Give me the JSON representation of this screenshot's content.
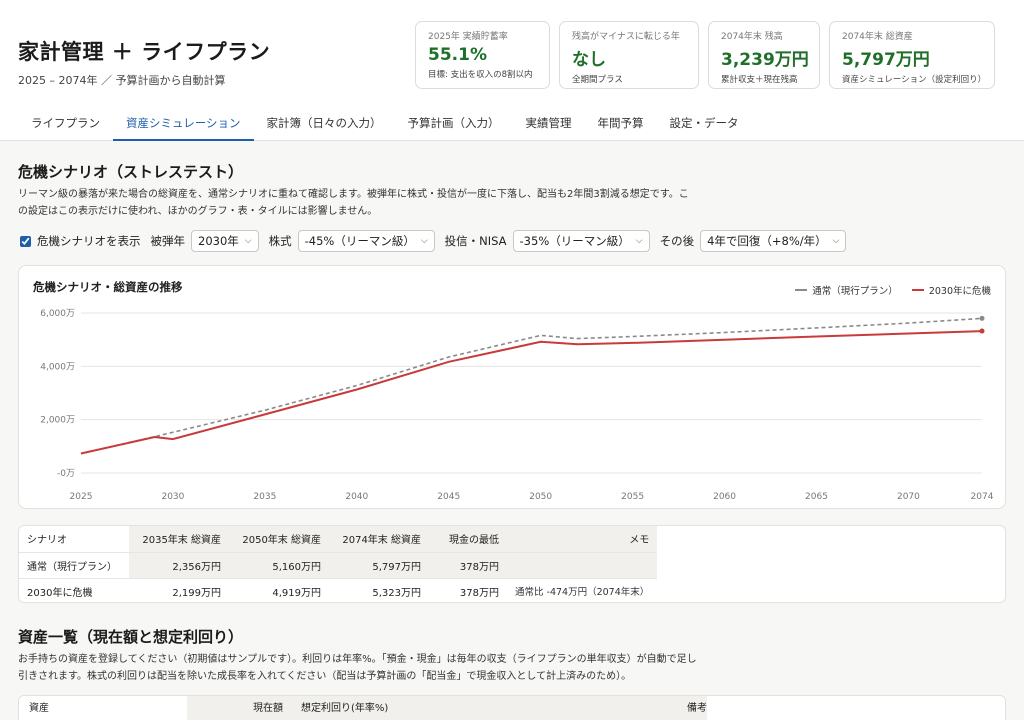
{
  "header": {
    "title": "家計管理 ＋ ライフプラン",
    "subtitle": "2025 – 2074年 ／ 予算計画から自動計算"
  },
  "kpis": [
    {
      "label": "2025年 実績貯蓄率",
      "value": "55.1%",
      "note": "目標: 支出を収入の8割以内"
    },
    {
      "label": "残高がマイナスに転じる年",
      "value": "なし",
      "note": "全期間プラス"
    },
    {
      "label": "2074年末 残高",
      "value": "3,239万円",
      "note": "累計収支＋現在残高"
    },
    {
      "label": "2074年末 総資産",
      "value": "5,797万円",
      "note": "資産シミュレーション（設定利回り）"
    }
  ],
  "tabs": [
    {
      "label": "ライフプラン",
      "active": false
    },
    {
      "label": "資産シミュレーション",
      "active": true
    },
    {
      "label": "家計簿（日々の入力）",
      "active": false
    },
    {
      "label": "予算計画（入力）",
      "active": false
    },
    {
      "label": "実績管理",
      "active": false
    },
    {
      "label": "年間予算",
      "active": false
    },
    {
      "label": "設定・データ",
      "active": false
    }
  ],
  "crisis": {
    "title": "危機シナリオ（ストレステスト）",
    "desc1": "リーマン級の暴落が来た場合の総資産を、通常シナリオに重ねて確認します。被弾年に株式・投信が一度に下落し、配当も2年間3割減る想定です。こ",
    "desc2": "の設定はこの表示だけに使われ、ほかのグラフ・表・タイルには影響しません。",
    "checkbox_label": "危機シナリオを表示",
    "year_label": "被弾年",
    "year_value": "2030年",
    "stock_label": "株式",
    "stock_value": "-45%（リーマン級）",
    "fund_label": "投信・NISA",
    "fund_value": "-35%（リーマン級）",
    "after_label": "その後",
    "after_value": "4年で回復（+8%/年）"
  },
  "chart_data": {
    "type": "line",
    "title": "危機シナリオ・総資産の推移",
    "xlim": [
      2025,
      2074
    ],
    "ylim": [
      0,
      6000
    ],
    "x_ticks": [
      2025,
      2030,
      2035,
      2040,
      2045,
      2050,
      2055,
      2060,
      2065,
      2070,
      2074
    ],
    "x_tick_labels": [
      "2025",
      "2030",
      "2035",
      "2040",
      "2045",
      "2050",
      "2055",
      "2060",
      "2065",
      "2070",
      "2074"
    ],
    "y_ticks": [
      0,
      2000,
      4000,
      6000
    ],
    "y_tick_labels": [
      "-0万",
      "2,000万",
      "4,000万",
      "6,000万"
    ],
    "grid": true,
    "legend": "top-right",
    "series": [
      {
        "name": "通常（現行プラン）",
        "color": "#8a8a8a",
        "style": "dashed",
        "points": [
          [
            2025,
            730
          ],
          [
            2029,
            1360
          ],
          [
            2035,
            2356
          ],
          [
            2040,
            3280
          ],
          [
            2045,
            4350
          ],
          [
            2050,
            5160
          ],
          [
            2052,
            5040
          ],
          [
            2055,
            5120
          ],
          [
            2060,
            5270
          ],
          [
            2065,
            5440
          ],
          [
            2070,
            5620
          ],
          [
            2074,
            5797
          ]
        ]
      },
      {
        "name": "2030年に危機",
        "color": "#c93a3a",
        "style": "solid",
        "points": [
          [
            2025,
            730
          ],
          [
            2029,
            1350
          ],
          [
            2030,
            1270
          ],
          [
            2035,
            2199
          ],
          [
            2040,
            3130
          ],
          [
            2045,
            4170
          ],
          [
            2050,
            4919
          ],
          [
            2052,
            4830
          ],
          [
            2055,
            4880
          ],
          [
            2060,
            5000
          ],
          [
            2065,
            5120
          ],
          [
            2070,
            5230
          ],
          [
            2074,
            5323
          ]
        ]
      }
    ]
  },
  "table": {
    "headers": [
      "シナリオ",
      "2035年末 総資産",
      "2050年末 総資産",
      "2074年末 総資産",
      "現金の最低",
      "メモ"
    ],
    "rows": [
      [
        "通常（現行プラン）",
        "2,356万円",
        "5,160万円",
        "5,797万円",
        "378万円",
        ""
      ],
      [
        "2030年に危機",
        "2,199万円",
        "4,919万円",
        "5,323万円",
        "378万円",
        "通常比 -474万円（2074年末）"
      ]
    ]
  },
  "assets": {
    "title": "資産一覧（現在額と想定利回り）",
    "desc1": "お手持ちの資産を登録してください（初期値はサンプルです）。利回りは年率%。「預金・現金」は毎年の収支（ライフプランの単年収支）が自動で足し",
    "desc2": "引きされます。株式の利回りは配当を除いた成長率を入れてください（配当は予算計画の「配当金」で現金収入として計上済みのため）。",
    "headers": [
      "資産",
      "現在額",
      "想定利回り(年率%)",
      "備考"
    ]
  }
}
